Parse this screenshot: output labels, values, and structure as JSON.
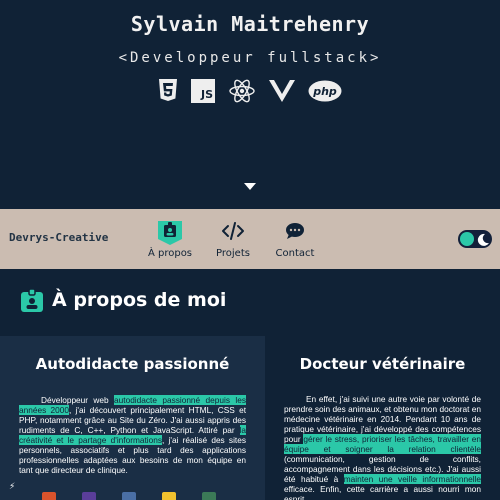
{
  "hero": {
    "name": "Sylvain Maitrehenry",
    "role": "<Developpeur fullstack>",
    "tech_icons": [
      "html5-icon",
      "javascript-icon",
      "react-icon",
      "vue-icon",
      "php-icon"
    ],
    "js_label": "JS",
    "php_label": "php"
  },
  "nav": {
    "brand": "Devrys-Creative",
    "items": [
      {
        "label": "À propos",
        "icon": "id-badge-icon",
        "active": true
      },
      {
        "label": "Projets",
        "icon": "code-icon",
        "active": false
      },
      {
        "label": "Contact",
        "icon": "chat-icon",
        "active": false
      }
    ],
    "theme_toggle": {
      "state": "dark",
      "icon": "moon-icon"
    }
  },
  "section": {
    "title": "À propos de moi",
    "icon": "id-badge-icon"
  },
  "cards": {
    "left": {
      "title": "Autodidacte passionné",
      "p1": "Développeur web ",
      "h1": "autodidacte passionné depuis les années 2000",
      "p2": ", j'ai découvert principalement HTML, CSS et PHP, notamment grâce au Site du Zéro. J'ai aussi appris des rudiments de C, C++, Python et JavaScript. Attiré par ",
      "h2": "la créativité et le partage d'informations",
      "p3": ", j'ai réalisé des sites personnels, associatifs et plus tard des applications professionnelles adaptées aux besoins de mon équipe en tant que directeur de clinique."
    },
    "right": {
      "title": "Docteur vétérinaire",
      "p1": "En effet, j'ai suivi une autre voie par volonté de prendre soin des animaux, et obtenu mon doctorat en médecine vétérinaire en 2014. Pendant 10 ans de pratique vétérinaire, j'ai développé des compétences pour ",
      "h1": "gérer le stress, prioriser les tâches, travailler en équipe et soigner la relation clientèle",
      "p2": " (communication, gestion de conflits, accompagnement dans les décisions etc.). J'ai aussi été habitué à ",
      "h2": "mainten une veille informationnelle",
      "p3": " efficace. Enfin, cette carrière a aussi nourri mon esprit"
    }
  },
  "colors": {
    "background": "#102236",
    "card_alt": "#1a2e45",
    "navbar": "#cbbcb1",
    "accent": "#2bc8a8"
  }
}
